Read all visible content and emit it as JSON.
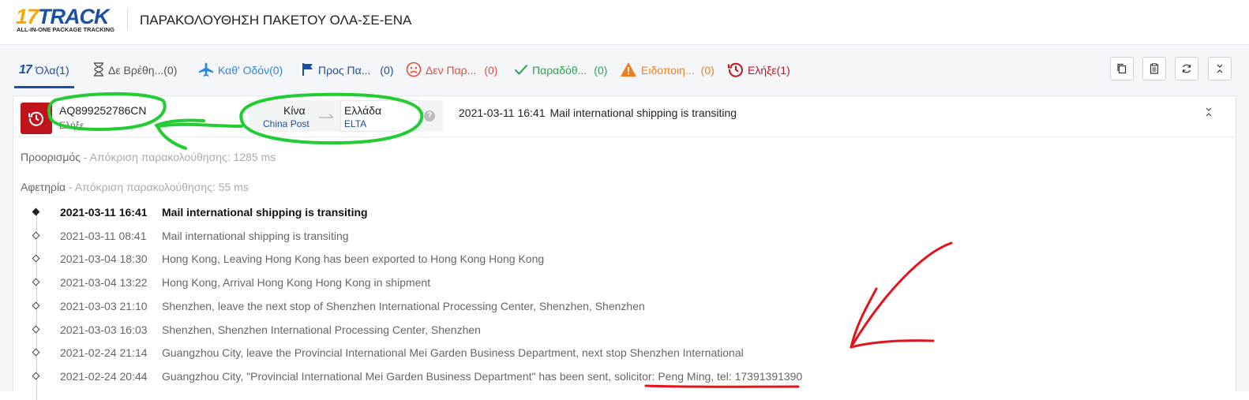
{
  "header": {
    "logo_number": "17",
    "logo_word": "TRACK",
    "logo_tagline": "ALL-IN-ONE PACKAGE TRACKING",
    "title": "ΠΑΡΑΚΟΛΟΥΘΗΣΗ ΠΑΚΕΤΟΥ ΟΛΑ-ΣΕ-ΕΝΑ"
  },
  "tabs": [
    {
      "label": "Όλα(1)",
      "icon": "17track-icon",
      "color": "#1b4fa3"
    },
    {
      "label": "Δε Βρέθη...(0)",
      "icon": "hourglass-icon",
      "color": "#555555"
    },
    {
      "label": "Καθ' Οδόν(0)",
      "icon": "airplane-icon",
      "color": "#2e86de"
    },
    {
      "label": "Προς Πα...",
      "count": "(0)",
      "icon": "flag-icon",
      "color": "#1b4fa3"
    },
    {
      "label": "Δεν Παρ...",
      "count": "(0)",
      "icon": "sad-face-icon",
      "color": "#e74c3c"
    },
    {
      "label": "Παραδόθ...",
      "count": "(0)",
      "icon": "check-icon",
      "color": "#27a745"
    },
    {
      "label": "Ειδοποιη...",
      "count": "(0)",
      "icon": "warning-icon",
      "color": "#f07d1a"
    },
    {
      "label": "Ελήξε(1)",
      "icon": "history-icon",
      "color": "#c0141c"
    }
  ],
  "toolbar": {
    "buttons": [
      "copy-icon",
      "paste-icon",
      "refresh-icon",
      "collapse-all-icon"
    ]
  },
  "shipment": {
    "tracking_number": "AQ899252786CN",
    "status": "Ελήξε",
    "origin_country": "Κίνα",
    "origin_carrier": "China Post",
    "destination_country": "Ελλάδα",
    "destination_carrier": "ELTA",
    "help": "?",
    "latest_time": "2021-03-11 16:41",
    "latest_desc": "Mail international shipping is transiting"
  },
  "sections": {
    "destination_label": "Προορισμός",
    "destination_sub": "- Απόκριση παρακολούθησης: 1285 ms",
    "origin_label": "Αφετηρία",
    "origin_sub": "- Απόκριση παρακολούθησης: 55 ms"
  },
  "events": [
    {
      "time": "2021-03-11 16:41",
      "desc": "Mail international shipping is transiting"
    },
    {
      "time": "2021-03-11 08:41",
      "desc": "Mail international shipping is transiting"
    },
    {
      "time": "2021-03-04 18:30",
      "desc": "Hong Kong, Leaving Hong Kong has been exported to Hong Kong Hong Kong"
    },
    {
      "time": "2021-03-04 13:22",
      "desc": "Hong Kong, Arrival Hong Kong Hong Kong in shipment"
    },
    {
      "time": "2021-03-03 21:10",
      "desc": "Shenzhen, leave the next stop of Shenzhen International Processing Center, Shenzhen, Shenzhen"
    },
    {
      "time": "2021-03-03 16:03",
      "desc": "Shenzhen, Shenzhen International Processing Center, Shenzhen"
    },
    {
      "time": "2021-02-24 21:14",
      "desc": "Guangzhou City, leave the Provincial International Mei Garden Business Department, next stop Shenzhen International"
    },
    {
      "time": "2021-02-24 20:44",
      "desc": "Guangzhou City, \"Provincial International Mei Garden Business Department\" has been sent, solicitor: Peng Ming, tel: 17391391390"
    }
  ],
  "colors": {
    "brand_blue": "#1b4fa3",
    "brand_orange": "#f7a600",
    "expired_red": "#c0141c",
    "annotation_green": "#22cc33",
    "annotation_red": "#e3121b"
  }
}
